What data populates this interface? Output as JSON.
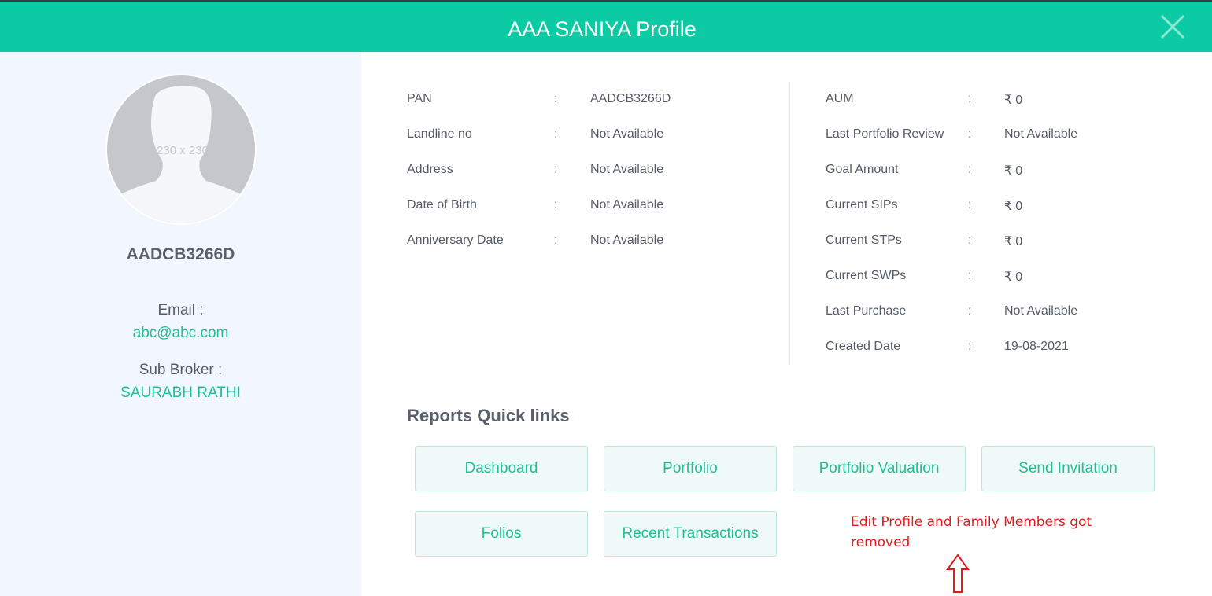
{
  "header": {
    "title": "AAA SANIYA Profile",
    "close_icon": "close-icon",
    "bg_color": "#0ccaa3"
  },
  "sidebar": {
    "avatar_placeholder": "230 x 230",
    "profile_id": "AADCB3266D",
    "email_label": "Email :",
    "email_value": "abc@abc.com",
    "sub_broker_label": "Sub Broker :",
    "sub_broker_value": "SAURABH RATHI"
  },
  "details_left": [
    {
      "label": "PAN",
      "sep": ":",
      "value": "AADCB3266D"
    },
    {
      "label": "Landline no",
      "sep": ":",
      "value": "Not Available"
    },
    {
      "label": "Address",
      "sep": ":",
      "value": "Not Available"
    },
    {
      "label": "Date of Birth",
      "sep": ":",
      "value": "Not Available"
    },
    {
      "label": "Anniversary Date",
      "sep": ":",
      "value": "Not Available"
    }
  ],
  "details_right": [
    {
      "label": "AUM",
      "sep": ":",
      "currency": "₹",
      "value": "0"
    },
    {
      "label": "Last Portfolio Review",
      "sep": ":",
      "value": "Not Available"
    },
    {
      "label": "Goal Amount",
      "sep": ":",
      "currency": "₹",
      "value": "0"
    },
    {
      "label": "Current SIPs",
      "sep": ":",
      "currency": "₹",
      "value": "0"
    },
    {
      "label": "Current STPs",
      "sep": ":",
      "currency": "₹",
      "value": "0"
    },
    {
      "label": "Current SWPs",
      "sep": ":",
      "currency": "₹",
      "value": "0"
    },
    {
      "label": "Last Purchase",
      "sep": ":",
      "value": "Not Available"
    },
    {
      "label": "Created Date",
      "sep": ":",
      "value": "19-08-2021"
    }
  ],
  "quick_links": {
    "title": "Reports Quick links",
    "buttons": [
      "Dashboard",
      "Portfolio",
      "Portfolio Valuation",
      "Send Invitation",
      "Folios",
      "Recent Transactions"
    ]
  },
  "annotation": {
    "text": "Edit Profile and Family Members got removed",
    "arrow_icon": "up-arrow-icon",
    "color": "#e31b1b"
  }
}
